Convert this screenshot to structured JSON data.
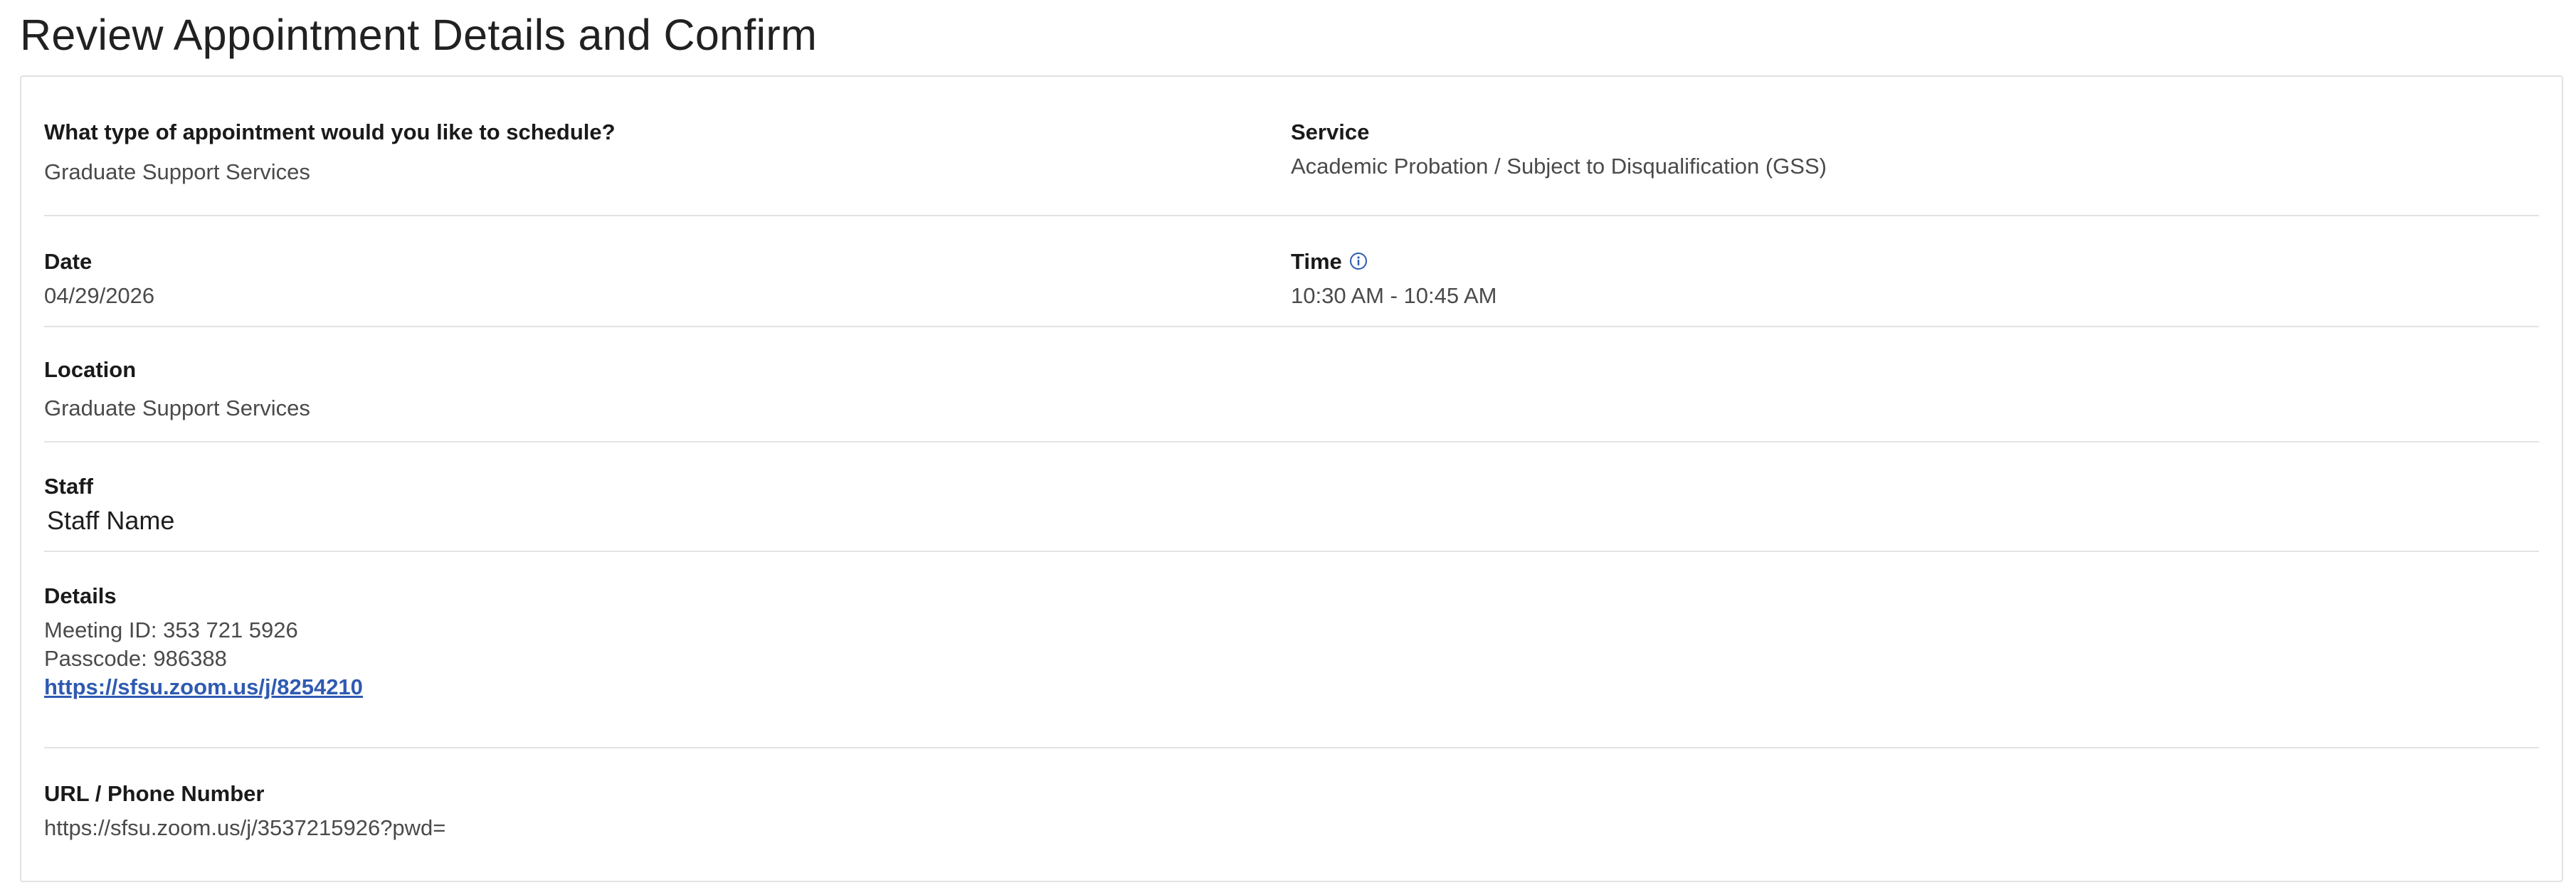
{
  "page": {
    "title": "Review Appointment Details and Confirm"
  },
  "appointment": {
    "type_label": "What type of appointment would you like to schedule?",
    "type_value": "Graduate Support Services",
    "service_label": "Service",
    "service_value": "Academic Probation / Subject to Disqualification (GSS)",
    "date_label": "Date",
    "date_value": "04/29/2026",
    "time_label": "Time",
    "time_value": "10:30 AM - 10:45 AM",
    "time_icon": "info-circle-icon",
    "location_label": "Location",
    "location_value": "Graduate Support Services",
    "staff_label": "Staff",
    "staff_value": "Staff Name",
    "details_label": "Details",
    "details_meeting_id": "Meeting ID: 353 721 5926",
    "details_passcode": "Passcode: 986388",
    "details_link": "https://sfsu.zoom.us/j/8254210",
    "url_label": "URL / Phone Number",
    "url_value": "https://sfsu.zoom.us/j/3537215926?pwd="
  },
  "colors": {
    "link": "#2f5ab2",
    "icon": "#2f5ab2",
    "divider": "#e3e3e3"
  }
}
